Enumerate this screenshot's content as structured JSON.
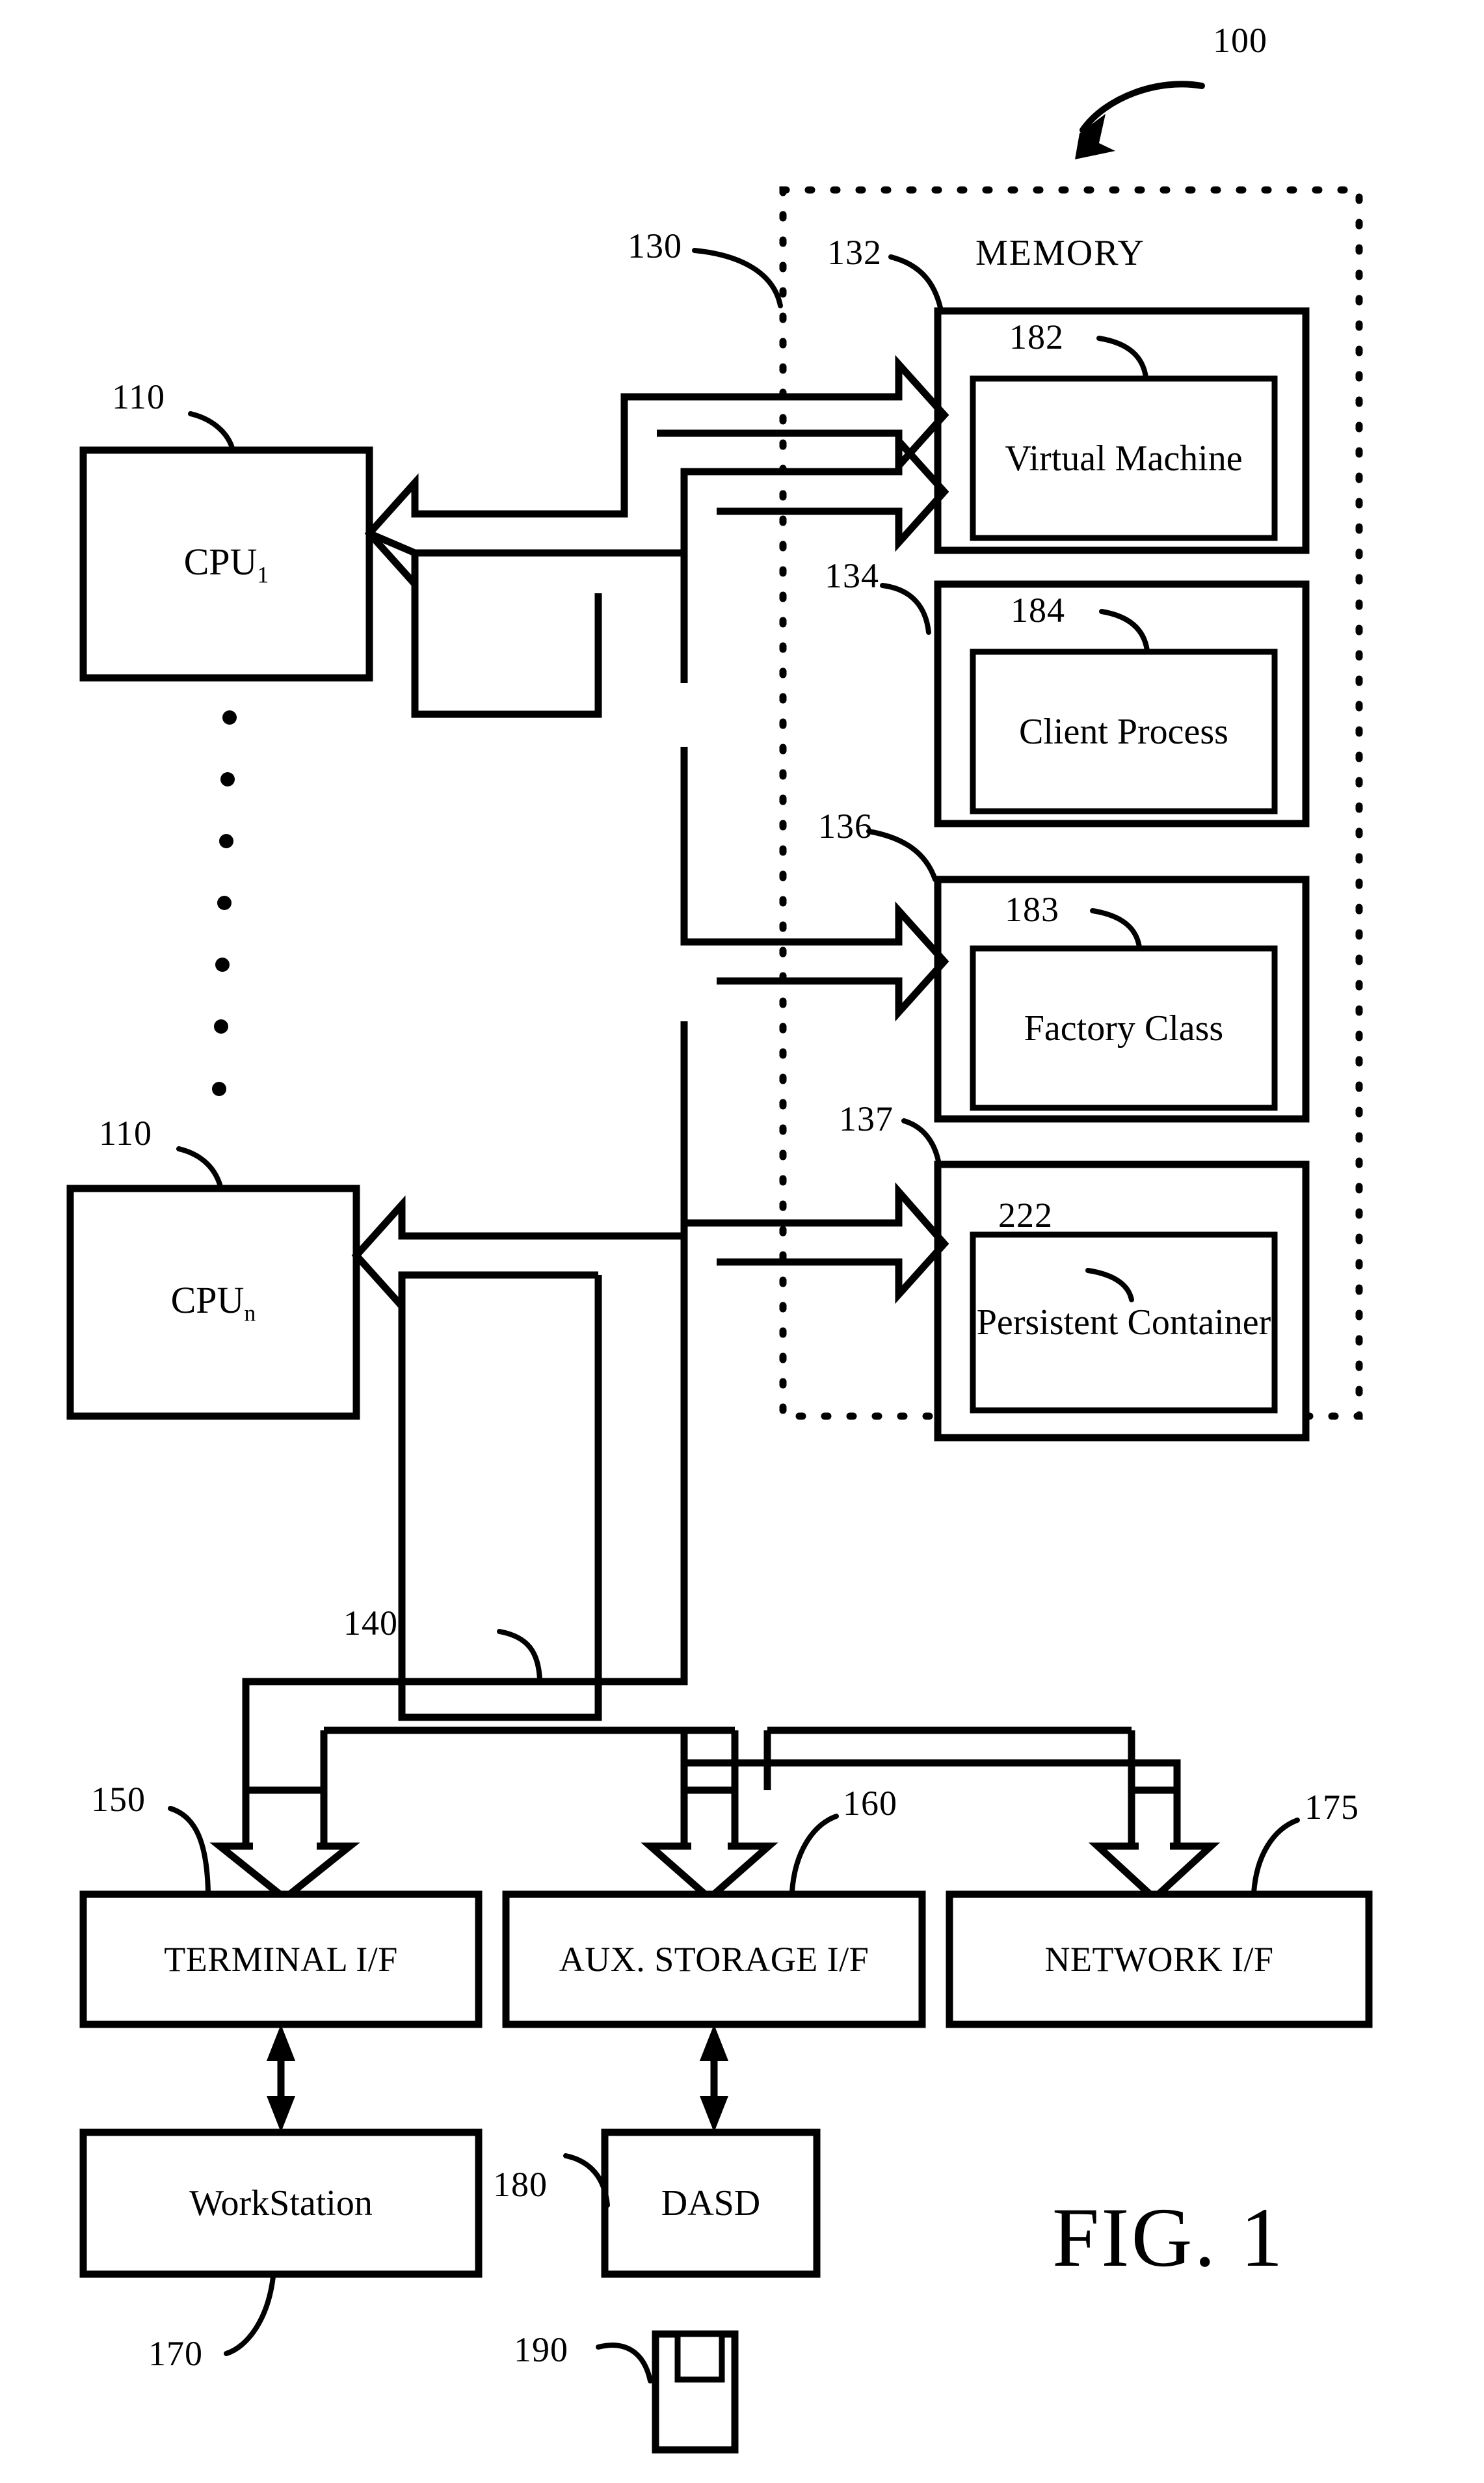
{
  "figure": {
    "caption": "FIG. 1",
    "system_ref": "100"
  },
  "memory_region": {
    "title": "MEMORY",
    "ref_outer": "130",
    "ref_title": "132",
    "blocks": [
      {
        "outer_ref": "132",
        "inner_ref": "182",
        "label": "Virtual Machine"
      },
      {
        "outer_ref": "134",
        "inner_ref": "184",
        "label": "Client Process"
      },
      {
        "outer_ref": "136",
        "inner_ref": "183",
        "label": "Factory Class"
      },
      {
        "outer_ref": "137",
        "inner_ref": "222",
        "label": "Persistent Container"
      }
    ]
  },
  "processors": [
    {
      "ref": "110",
      "label": "CPU",
      "subscript": "1"
    },
    {
      "ref": "110",
      "label": "CPU",
      "subscript": "n"
    }
  ],
  "bus": {
    "ref": "140"
  },
  "interfaces": [
    {
      "ref": "150",
      "label": "TERMINAL I/F"
    },
    {
      "ref": "160",
      "label": "AUX. STORAGE I/F"
    },
    {
      "ref": "175",
      "label": "NETWORK I/F"
    }
  ],
  "devices": [
    {
      "ref": "170",
      "label": "WorkStation"
    },
    {
      "ref": "180",
      "label": "DASD"
    },
    {
      "ref": "190",
      "label": "",
      "icon": "floppy-disk-icon"
    }
  ],
  "ellipsis": {
    "dot_count": 7
  }
}
